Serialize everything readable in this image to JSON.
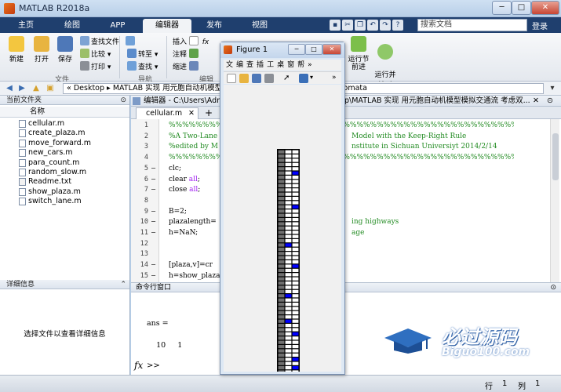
{
  "window": {
    "title": "MATLAB R2018a"
  },
  "tabs": [
    {
      "label": "主页"
    },
    {
      "label": "绘图"
    },
    {
      "label": "APP"
    },
    {
      "label": "编辑器"
    },
    {
      "label": "发布"
    },
    {
      "label": "视图"
    }
  ],
  "search": {
    "placeholder": "搜索文档"
  },
  "login_label": "登录",
  "ribbon": {
    "file": {
      "new": "新建",
      "open": "打开",
      "save": "保存",
      "find_files": "查找文件",
      "compare": "比较",
      "print": "打印",
      "group": "文件"
    },
    "navigate": {
      "goto": "转至",
      "find": "查找",
      "group": "导航"
    },
    "edit": {
      "insert": "插入",
      "comment": "注释",
      "indent": "缩进",
      "group": "编辑"
    },
    "run": {
      "run_section": "运行节",
      "advance": "前进",
      "run_time": "运行并\n计时"
    }
  },
  "address": {
    "path": "«  Desktop  ▸  MATLAB 实现 用元胞自动机模型模拟交通流 考虑双车道          cellular automata"
  },
  "current_folder": {
    "title": "当前文件夹",
    "column": "名称",
    "files": [
      {
        "name": "cellular.m"
      },
      {
        "name": "create_plaza.m"
      },
      {
        "name": "move_forward.m"
      },
      {
        "name": "new_cars.m"
      },
      {
        "name": "para_count.m"
      },
      {
        "name": "random_slow.m"
      },
      {
        "name": "Readme.txt"
      },
      {
        "name": "show_plaza.m"
      },
      {
        "name": "switch_lane.m"
      }
    ]
  },
  "details": {
    "title": "详细信息",
    "hint": "选择文件以查看详细信息"
  },
  "editor": {
    "header": "编辑器 - C:\\Users\\Adm",
    "header_right": "p\\MATLAB 实现 用元胞自动机模型模拟交通流 考虑双...",
    "tab": "cellular.m",
    "lines": [
      {
        "n": "1",
        "dash": "",
        "text": "%%%%%%%%%%%%%%%%%%%%%%%%%%%%%%%%%%%%%%%%%%%%%%%%%%%%%%%%%%%%%%%%%%%%%%%%%%%%",
        "cls": "cm"
      },
      {
        "n": "2",
        "dash": "",
        "text": "%A Two-Lane C",
        "cls": "cm",
        "tail": "Model with the Keep-Right Rule"
      },
      {
        "n": "3",
        "dash": "",
        "text": "%edited by M",
        "cls": "cm",
        "tail": "nstitute in Sichuan Universiyt 2014/2/14"
      },
      {
        "n": "4",
        "dash": "",
        "text": "%%%%%%%%%%%%%%%%%%%%%%%%%%%%%%%%%%%%%%%%%%%%%%%%%%%%%%%%%%%%%%%%%%%%%%%%%%%%",
        "cls": "cm"
      },
      {
        "n": "5",
        "dash": "-",
        "text": "clc;",
        "cls": ""
      },
      {
        "n": "6",
        "dash": "-",
        "text": "clear ",
        "cls": "",
        "kw": "all",
        "after": ";"
      },
      {
        "n": "7",
        "dash": "-",
        "text": "close ",
        "cls": "",
        "kw": "all",
        "after": ";"
      },
      {
        "n": "8",
        "dash": "",
        "text": "",
        "cls": ""
      },
      {
        "n": "9",
        "dash": "-",
        "text": "B=2;",
        "cls": ""
      },
      {
        "n": "10",
        "dash": "-",
        "text": "plazalength=",
        "cls": "",
        "tail": "ing highways"
      },
      {
        "n": "11",
        "dash": "-",
        "text": "h=NaN;",
        "cls": "",
        "tail": "age"
      },
      {
        "n": "12",
        "dash": "",
        "text": "",
        "cls": ""
      },
      {
        "n": "13",
        "dash": "",
        "text": "",
        "cls": ""
      },
      {
        "n": "14",
        "dash": "-",
        "text": "[plaza,v]=cr",
        "cls": ""
      },
      {
        "n": "15",
        "dash": "-",
        "text": "h=show_plaza",
        "cls": ""
      }
    ]
  },
  "command": {
    "title": "命令行窗口",
    "ans_label": "ans =",
    "ans_values": "    10     1",
    "fx": "fx",
    "prompt": ">>"
  },
  "watermark": {
    "text": "必过源码",
    "url": "Biguo100.com"
  },
  "status": {
    "row_label": "行",
    "row": "1",
    "col_label": "列",
    "col": "1"
  },
  "figure": {
    "title": "Figure 1",
    "menu": [
      "文",
      "编",
      "查",
      "插",
      "工",
      "桌",
      "窗",
      "帮"
    ],
    "plaza": {
      "rows": 58,
      "cols": 3,
      "colors": {
        "border": "#000000",
        "road": "#ffffff",
        "car": "#0000ff",
        "cell": "#6f6f6f"
      },
      "cars": [
        [
          5,
          2
        ],
        [
          13,
          2
        ],
        [
          22,
          1
        ],
        [
          27,
          2
        ],
        [
          34,
          1
        ],
        [
          40,
          1
        ],
        [
          43,
          2
        ],
        [
          49,
          2
        ],
        [
          51,
          2
        ],
        [
          53,
          2
        ],
        [
          55,
          1
        ]
      ],
      "cells": [
        [
          0,
          0
        ],
        [
          1,
          0
        ],
        [
          2,
          0
        ],
        [
          3,
          0
        ],
        [
          4,
          0
        ],
        [
          5,
          0
        ],
        [
          6,
          0
        ],
        [
          7,
          0
        ],
        [
          8,
          0
        ],
        [
          9,
          0
        ],
        [
          10,
          0
        ],
        [
          11,
          0
        ],
        [
          12,
          0
        ],
        [
          13,
          0
        ],
        [
          14,
          0
        ],
        [
          15,
          0
        ],
        [
          16,
          0
        ],
        [
          17,
          0
        ],
        [
          18,
          0
        ],
        [
          19,
          0
        ],
        [
          20,
          0
        ],
        [
          21,
          0
        ],
        [
          22,
          0
        ],
        [
          23,
          0
        ],
        [
          24,
          0
        ],
        [
          25,
          0
        ],
        [
          26,
          0
        ],
        [
          27,
          0
        ],
        [
          28,
          0
        ],
        [
          29,
          0
        ],
        [
          30,
          0
        ],
        [
          31,
          0
        ],
        [
          32,
          0
        ],
        [
          33,
          0
        ],
        [
          34,
          0
        ],
        [
          35,
          0
        ],
        [
          36,
          0
        ],
        [
          37,
          0
        ],
        [
          38,
          0
        ],
        [
          39,
          0
        ],
        [
          40,
          0
        ],
        [
          41,
          0
        ],
        [
          42,
          0
        ],
        [
          43,
          0
        ],
        [
          44,
          0
        ],
        [
          45,
          0
        ],
        [
          46,
          0
        ],
        [
          47,
          0
        ],
        [
          48,
          0
        ],
        [
          49,
          0
        ],
        [
          50,
          0
        ],
        [
          51,
          0
        ],
        [
          52,
          0
        ],
        [
          53,
          0
        ],
        [
          54,
          0
        ],
        [
          55,
          0
        ],
        [
          56,
          0
        ],
        [
          57,
          0
        ]
      ]
    }
  }
}
